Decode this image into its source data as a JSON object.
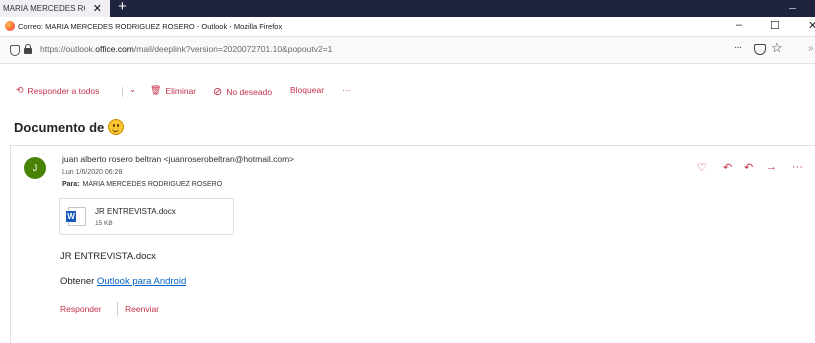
{
  "browser": {
    "tab_title": "MARIA MERCEDES RO...",
    "tab_close": "✕",
    "new_tab": "+",
    "window_title": "Correo: MARIA MERCEDES RODRIGUEZ ROSERO - Outlook - Mozilla Firefox",
    "controls": {
      "minimize": "–",
      "maximize": "☐",
      "close": "✕"
    },
    "url_prefix": "https://outlook.",
    "url_domain": "office.com",
    "url_suffix": "/mail/deeplink?version=2020072701.10&popoutv2=1",
    "url_more": "···",
    "star": "☆",
    "overflow": "»"
  },
  "toolbar": {
    "reply_all_icon": "⟲",
    "reply_all": "Responder a todos",
    "dropdown": "⌄",
    "delete_icon": "🗑",
    "delete": "Eliminar",
    "junk_icon": "⊘",
    "junk": "No deseado",
    "block": "Bloquear",
    "more": "···",
    "accent": "#c4314b"
  },
  "message": {
    "subject": "Documento de",
    "avatar_initial": "J",
    "avatar_color": "#498205",
    "from": "juan alberto rosero beltran <juanroserobeltran@hotmail.com>",
    "date": "Lun 1/6/2020 06:28",
    "to_label": "Para:",
    "to": "MARIA MERCEDES RODRIGUEZ ROSERO",
    "actions": {
      "like": "♡",
      "reply": "↶",
      "reply_all": "↶",
      "forward": "→",
      "more": "···"
    },
    "attachment": {
      "name": "JR ENTREVISTA.docx",
      "size": "15 KB",
      "icon": "word-icon"
    },
    "body_line1": "JR ENTREVISTA.docx",
    "body_prefix": "Obtener",
    "body_link": "Outlook para Android",
    "footer_reply": "Responder",
    "footer_forward": "Reenviar"
  }
}
